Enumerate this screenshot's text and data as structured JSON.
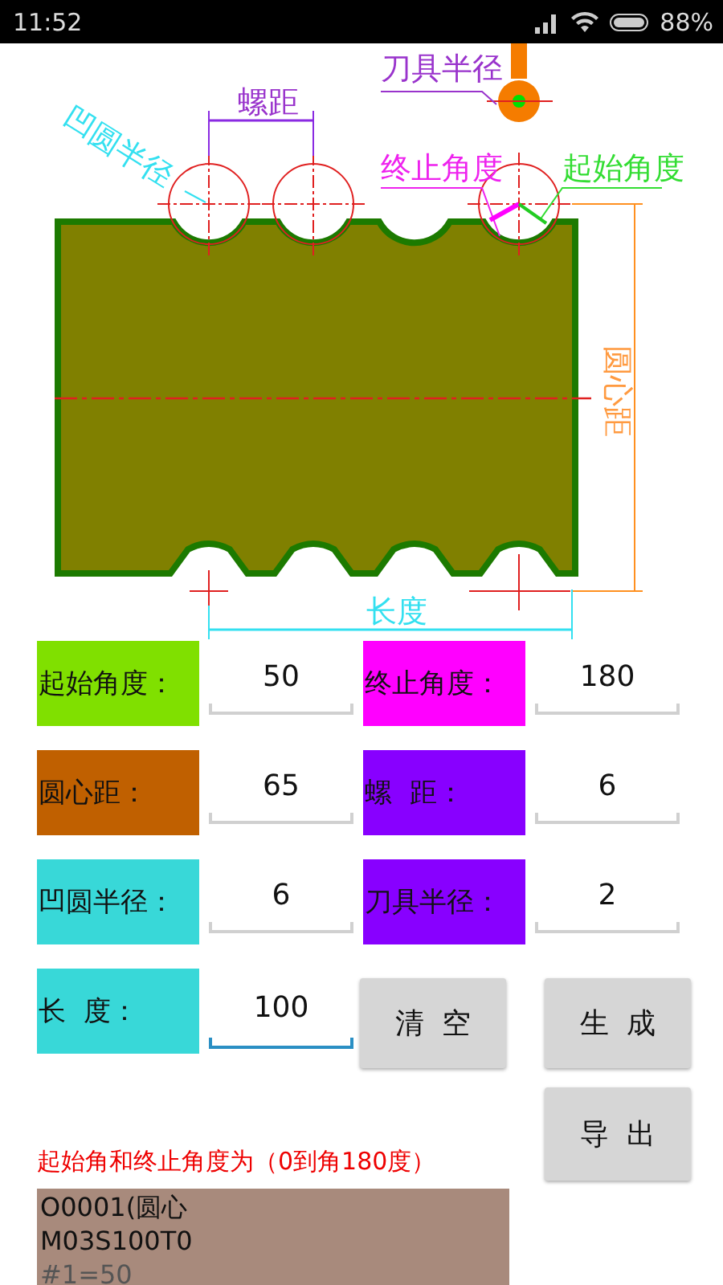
{
  "status_bar": {
    "time": "11:52",
    "battery": "88%"
  },
  "diagram": {
    "tool_radius": "刀具半径",
    "pitch": "螺距",
    "groove_radius": "凹圆半径",
    "end_angle": "终止角度",
    "start_angle": "起始角度",
    "center_distance": "圆心距",
    "length": "长度"
  },
  "params": [
    {
      "label": "起始角度：",
      "value": "50",
      "color": "#80e000",
      "focused": false
    },
    {
      "label": "终止角度：",
      "value": "180",
      "color": "#ff00ff",
      "focused": false
    },
    {
      "label": "圆心距：",
      "value": "65",
      "color": "#c06000",
      "focused": false
    },
    {
      "label": "螺  距：",
      "value": "6",
      "color": "#8800ff",
      "focused": false
    },
    {
      "label": "凹圆半径：",
      "value": "6",
      "color": "#38d8d8",
      "focused": false
    },
    {
      "label": "刀具半径：",
      "value": "2",
      "color": "#8800ff",
      "focused": false
    },
    {
      "label": "长  度：",
      "value": "100",
      "color": "#38d8d8",
      "focused": true
    }
  ],
  "buttons": [
    {
      "label": "清  空"
    },
    {
      "label": "生  成"
    },
    {
      "label": "导  出"
    }
  ],
  "note": "起始角和终止角度为（0到角180度）",
  "output": {
    "lines": [
      "O0001(圆心",
      "M03S100T0",
      "#1=50"
    ]
  }
}
